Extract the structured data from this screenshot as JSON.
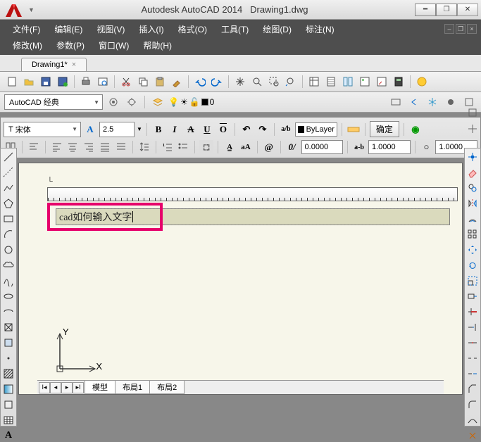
{
  "app": {
    "name": "Autodesk AutoCAD 2014",
    "document": "Drawing1.dwg"
  },
  "menus": {
    "row1": [
      {
        "k": "file",
        "label": "文件(F)"
      },
      {
        "k": "edit",
        "label": "编辑(E)"
      },
      {
        "k": "view",
        "label": "视图(V)"
      },
      {
        "k": "insert",
        "label": "插入(I)"
      },
      {
        "k": "format",
        "label": "格式(O)"
      },
      {
        "k": "tools",
        "label": "工具(T)"
      },
      {
        "k": "draw",
        "label": "绘图(D)"
      },
      {
        "k": "dimension",
        "label": "标注(N)"
      }
    ],
    "row2": [
      {
        "k": "modify",
        "label": "修改(M)"
      },
      {
        "k": "param",
        "label": "参数(P)"
      },
      {
        "k": "window",
        "label": "窗口(W)"
      },
      {
        "k": "help",
        "label": "帮助(H)"
      }
    ]
  },
  "tabs": {
    "drawing": "Drawing1*"
  },
  "workspace_combo": "AutoCAD 经典",
  "layer": {
    "current": "0"
  },
  "mtext": {
    "font": "宋体",
    "height": "2.5",
    "bylayer": "ByLayer",
    "ok": "确定",
    "tracking": "0.0000",
    "widthfactor": "1.0000",
    "oblique": "1.0000",
    "input": "cad如何输入文字"
  },
  "paper_tabs": {
    "model": "模型",
    "layout1": "布局1",
    "layout2": "布局2"
  },
  "ucs": {
    "x": "X",
    "y": "Y"
  }
}
